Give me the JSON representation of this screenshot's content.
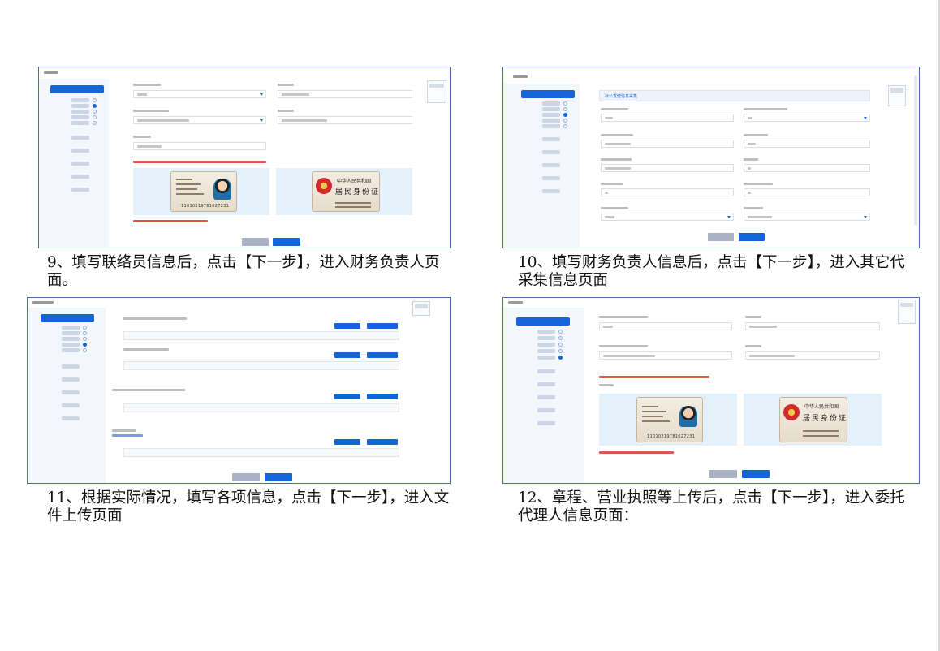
{
  "panel_10": {
    "section_heading": "补公发健信息采集"
  },
  "id_card_back": {
    "country": "中华人民共和国",
    "title": "居民身份证"
  },
  "id_card_front": {
    "number": "11010219781627231"
  },
  "captions": {
    "step9": "9、填写联络员信息后，点击【下一步】，进入财务负责人页面。",
    "step10": "10、填写财务负责人信息后，点击【下一步】，进入其它代采集信息页面",
    "step11": "11、根据实际情况，填写各项信息，点击【下一步】，进入文件上传页面",
    "step12": "12、章程、营业执照等上传后，点击【下一步】，进入委托代理人信息页面："
  }
}
